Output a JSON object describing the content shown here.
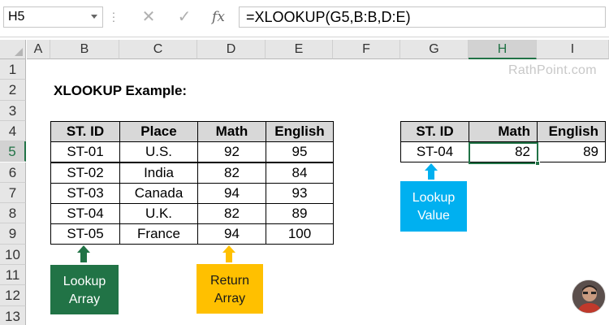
{
  "formula_bar": {
    "name_box": "H5",
    "cancel_icon": "✕",
    "enter_icon": "✓",
    "fx_label": "fx",
    "formula": "=XLOOKUP(G5,B:B,D:E)"
  },
  "columns": [
    "A",
    "B",
    "C",
    "D",
    "E",
    "F",
    "G",
    "H",
    "I"
  ],
  "rows": [
    "1",
    "2",
    "3",
    "4",
    "5",
    "6",
    "7",
    "8",
    "9",
    "10",
    "11",
    "12",
    "13"
  ],
  "selected_column": "H",
  "selected_row": "5",
  "watermark": "RathPoint.com",
  "title": "XLOOKUP Example:",
  "source_table": {
    "headers": [
      "ST. ID",
      "Place",
      "Math",
      "English"
    ],
    "rows": [
      [
        "ST-01",
        "U.S.",
        "92",
        "95"
      ],
      [
        "ST-02",
        "India",
        "82",
        "84"
      ],
      [
        "ST-03",
        "Canada",
        "94",
        "93"
      ],
      [
        "ST-04",
        "U.K.",
        "82",
        "89"
      ],
      [
        "ST-05",
        "France",
        "94",
        "100"
      ]
    ]
  },
  "result_table": {
    "headers": [
      "ST. ID",
      "Math",
      "English"
    ],
    "row": [
      "ST-04",
      "82",
      "89"
    ]
  },
  "callouts": {
    "lookup_array": {
      "line1": "Lookup",
      "line2": "Array",
      "color": "#217346"
    },
    "return_array": {
      "line1": "Return",
      "line2": "Array",
      "color": "#ffc000"
    },
    "lookup_value": {
      "line1": "Lookup",
      "line2": "Value",
      "color": "#00b0f0"
    }
  },
  "colors": {
    "accent": "#217346",
    "header_fill": "#d8d8d8"
  }
}
